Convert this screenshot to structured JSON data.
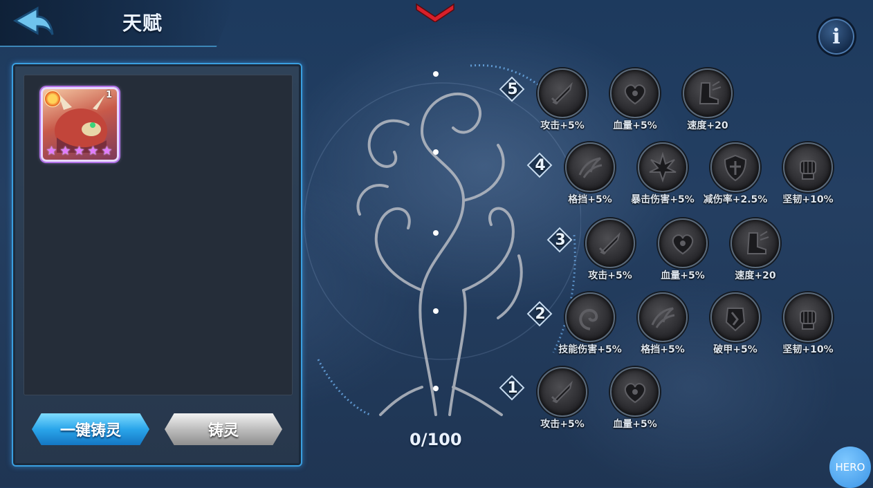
{
  "header": {
    "title": "天赋"
  },
  "hero_card": {
    "level": "1",
    "stars": 5,
    "element_icon": "fire-icon"
  },
  "buttons": {
    "auto_forge": "一键铸灵",
    "forge": "铸灵"
  },
  "points": "0/100",
  "fab": "HERO",
  "colors": {
    "accent_blue": "#2aa5ea",
    "panel_border": "#3a9fe0",
    "star_purple": "#e27bff"
  },
  "tiers": [
    {
      "num": "5",
      "talents": [
        {
          "label": "攻击+5%",
          "icon": "sword-icon"
        },
        {
          "label": "血量+5%",
          "icon": "heart-icon"
        },
        {
          "label": "速度+20",
          "icon": "boot-icon"
        }
      ]
    },
    {
      "num": "4",
      "talents": [
        {
          "label": "格挡+5%",
          "icon": "claw-icon"
        },
        {
          "label": "暴击伤害+5%",
          "icon": "burst-icon"
        },
        {
          "label": "减伤率+2.5%",
          "icon": "shield-icon"
        },
        {
          "label": "坚韧+10%",
          "icon": "fist-icon"
        }
      ]
    },
    {
      "num": "3",
      "talents": [
        {
          "label": "攻击+5%",
          "icon": "sword-icon"
        },
        {
          "label": "血量+5%",
          "icon": "heart-icon"
        },
        {
          "label": "速度+20",
          "icon": "boot-icon"
        }
      ]
    },
    {
      "num": "2",
      "talents": [
        {
          "label": "技能伤害+5%",
          "icon": "swirl-icon"
        },
        {
          "label": "格挡+5%",
          "icon": "claw-icon"
        },
        {
          "label": "破甲+5%",
          "icon": "armor-break-icon"
        },
        {
          "label": "坚韧+10%",
          "icon": "fist-icon"
        }
      ]
    },
    {
      "num": "1",
      "talents": [
        {
          "label": "攻击+5%",
          "icon": "sword-icon"
        },
        {
          "label": "血量+5%",
          "icon": "heart-icon"
        }
      ]
    }
  ]
}
